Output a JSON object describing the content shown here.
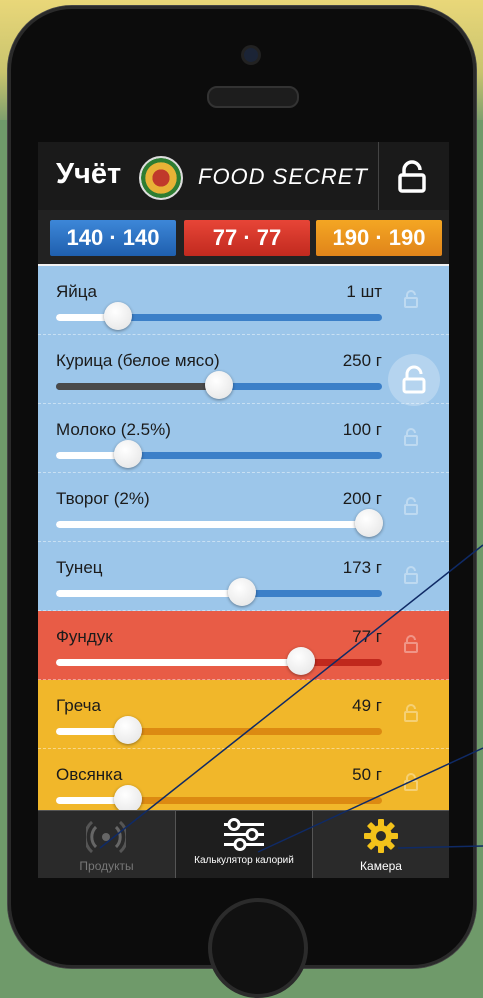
{
  "header": {
    "title": "Учёт",
    "brand": "FOOD SECRET"
  },
  "macros": [
    {
      "label": "140 · 140",
      "color": "#2f74c4"
    },
    {
      "label": "77 · 77",
      "color": "#d43528"
    },
    {
      "label": "190 · 190",
      "color": "#ea9820"
    }
  ],
  "products": [
    {
      "name": "Яйца",
      "amount": "1 шт",
      "level": 0.19,
      "theme": "blue",
      "track": "#3b7fc8"
    },
    {
      "name": "Курица (белое мясо)",
      "amount": "250 г",
      "level": 0.5,
      "theme": "blue",
      "track": "#3b7fc8",
      "filled_dark": true
    },
    {
      "name": "Молоко (2.5%)",
      "amount": "100 г",
      "level": 0.22,
      "theme": "blue",
      "track": "#3b7fc8"
    },
    {
      "name": "Творог (2%)",
      "amount": "200 г",
      "level": 0.96,
      "theme": "blue",
      "track": "#3b7fc8"
    },
    {
      "name": "Тунец",
      "amount": "173 г",
      "level": 0.57,
      "theme": "blue",
      "track": "#3b7fc8"
    },
    {
      "name": "Фундук",
      "amount": "77 г",
      "level": 0.75,
      "theme": "red",
      "track": "#c0281d"
    },
    {
      "name": "Греча",
      "amount": "49 г",
      "level": 0.22,
      "theme": "orange",
      "track": "#dc8a12"
    },
    {
      "name": "Овсянка",
      "amount": "50 г",
      "level": 0.22,
      "theme": "orange",
      "track": "#dc8a12"
    }
  ],
  "tabs": [
    {
      "label": "Продукты",
      "icon": "radar-icon"
    },
    {
      "label": "Калькулятор калорий",
      "icon": "sliders-icon"
    },
    {
      "label": "Камера",
      "icon": "gear-icon"
    }
  ]
}
